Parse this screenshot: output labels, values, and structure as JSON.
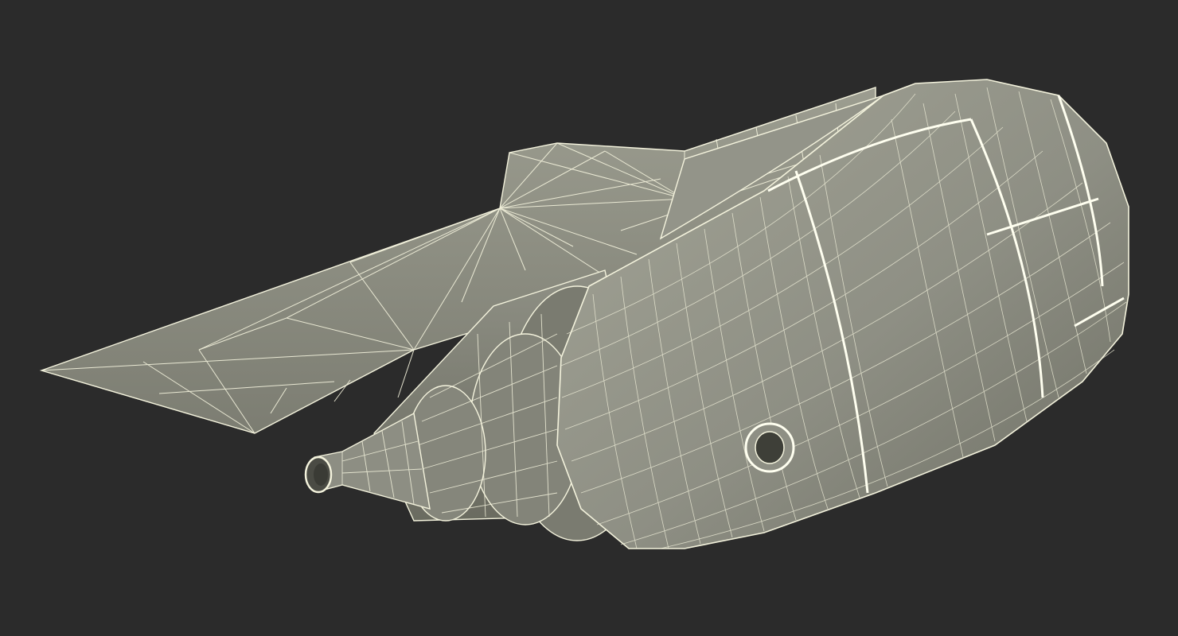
{
  "scene": {
    "subject": "turbofan-engine-nacelle-with-pylon",
    "render_style": "wireframe-over-shaded",
    "colors": {
      "background": "#2b2b2b",
      "surface": "#8e8f84",
      "surface_light": "#a4a597",
      "surface_dark": "#6a6b60",
      "wire": "#f4f3dd",
      "wire_strong": "#fffff0"
    }
  }
}
